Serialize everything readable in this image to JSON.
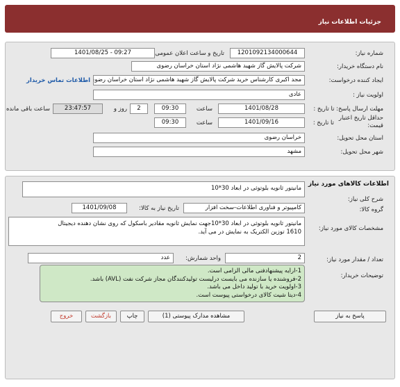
{
  "header": {
    "title": "جزئیات اطلاعات نیاز"
  },
  "need": {
    "number_label": "شماره نیاز:",
    "number_value": "1201092134000644",
    "announce_label": "تاریخ و ساعت اعلان عمومی:",
    "announce_value": "1401/08/25 - 09:27",
    "buyer_label": "نام دستگاه خریدار:",
    "buyer_value": "شرکت پالایش گاز شهید هاشمی نژاد   استان خراسان رضوی",
    "creator_label": "ایجاد کننده درخواست:",
    "creator_value": "مجد اکبری کارشناس خرید شرکت پالایش گاز شهید هاشمی نژاد   استان خراسان رضوی",
    "contact_link": "اطلاعات تماس خریدار",
    "priority_label": "اولویت نیاز :",
    "priority_value": "عادی",
    "deadline_label": "مهلت ارسال پاسخ: تا تاریخ :",
    "deadline_date": "1401/08/28",
    "time_label": "ساعت",
    "deadline_time": "09:30",
    "days_value": "2",
    "days_and_label": "روز و",
    "remaining_time": "23:47:57",
    "remaining_label": "ساعت باقی مانده",
    "validity_label_1": "حداقل تاریخ اعتبار",
    "validity_label_2": "قیمت:",
    "validity_until_label": "تا تاریخ :",
    "validity_date": "1401/09/16",
    "validity_time": "09:30",
    "province_label": "استان محل تحویل:",
    "province_value": "خراسان رضوی",
    "city_label": "شهر محل تحویل:",
    "city_value": "مشهد"
  },
  "goods": {
    "section_title": "اطلاعات کالاهای مورد نیاز",
    "desc_label": "شرح کلی نیاز:",
    "desc_value": "مانیتور ثانویه بلوتوثی در ابعاد 30*10",
    "group_label": "گروه کالا:",
    "group_value": "کامپیوتر و فناوری اطلاعات-سخت افزار",
    "need_date_label": "تاریخ نیاز به کالا:",
    "need_date_value": "1401/09/08",
    "spec_label": "مشخصات کالای مورد نیاز:",
    "spec_line1": "مانیتور ثانویه بلوتوثی در ابعاد 30*10جهت نمایش ثانویه مقادیر باسکول که روی نشان دهنده دیجیتال",
    "spec_line2": "1610 توزین الکتریک به نمایش در می آید.",
    "qty_label": "تعداد / مقدار مورد نیاز:",
    "qty_value": "2",
    "unit_label": "واحد شمارش:",
    "unit_value": "عدد",
    "notes_label": "توضیحات خریدار:",
    "notes": [
      "1-ارایه پیشنهادفنی مالی الزامی است.",
      "2-فروشنده یا سازنده می بایست درلیست تولیدکنندگان مجاز شرکت نفت (AVL)  باشد.",
      "3-اولویت خرید با  تولید داخل می باشد.",
      "4-دیتا شیت کالای درخواستی پیوست است."
    ]
  },
  "actions": {
    "reply": "پاسخ به نیاز",
    "attachments": "مشاهده مدارک پیوستی (1)",
    "print": "چاپ",
    "back": "بازگشت",
    "exit": "خروج"
  }
}
